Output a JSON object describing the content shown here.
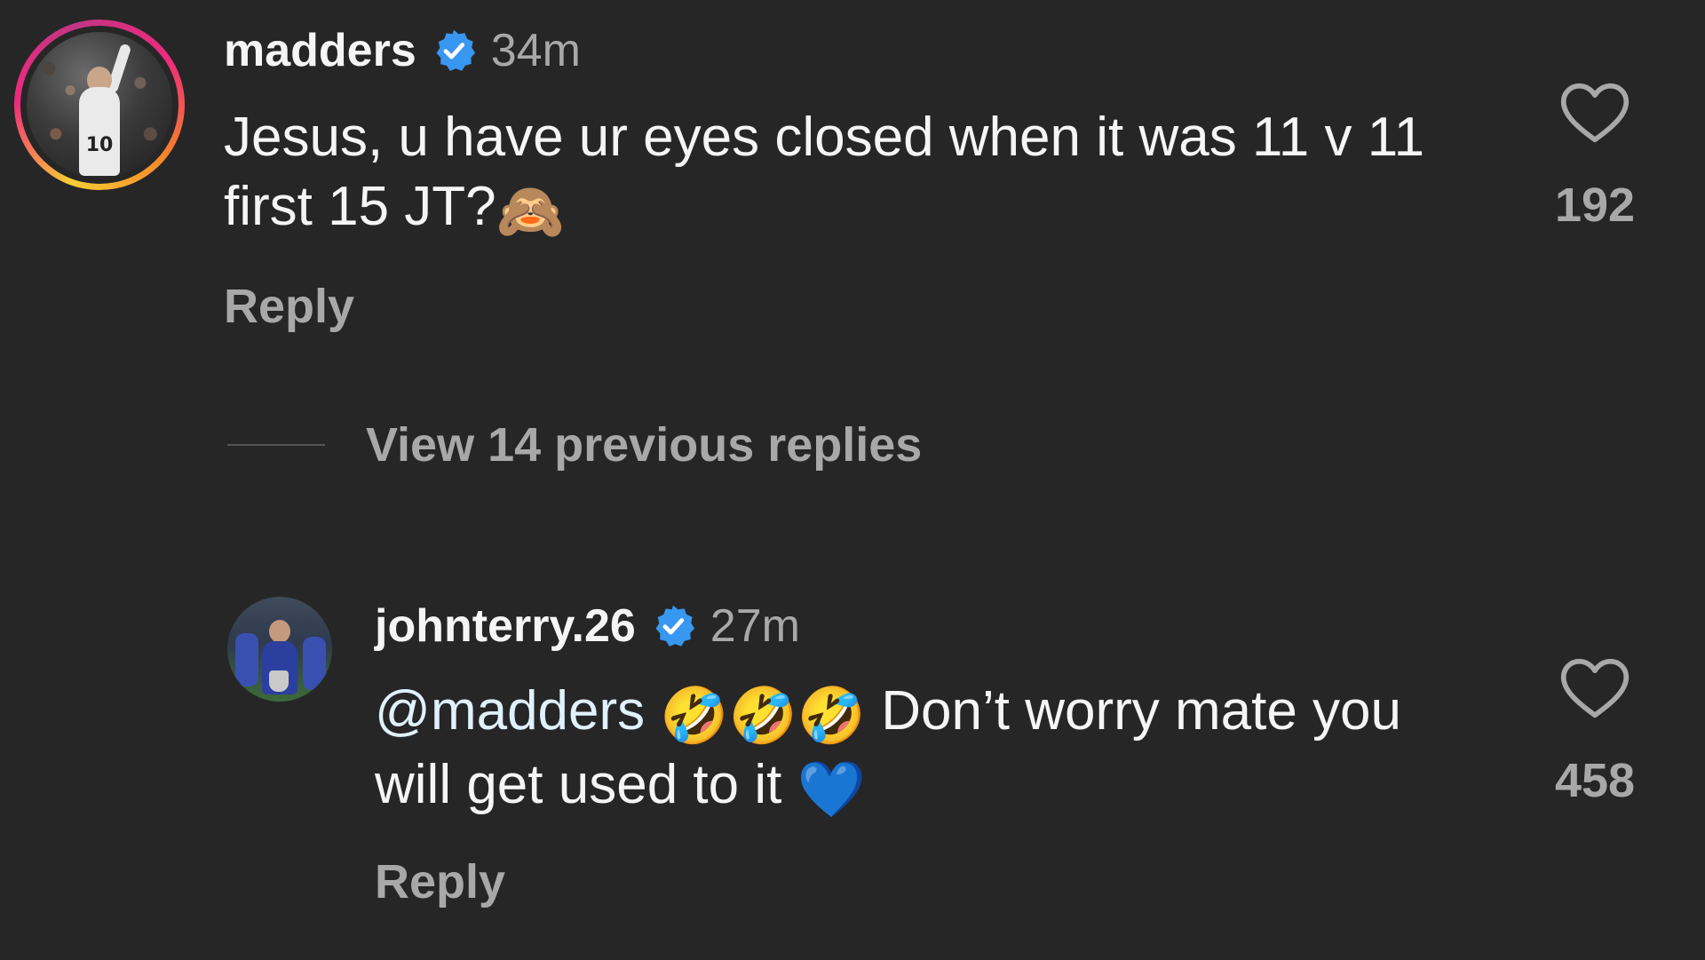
{
  "comment": {
    "username": "madders",
    "verified": true,
    "time": "34m",
    "text_main": "Jesus, u have ur eyes closed when it was 11 v 11 first 15 JT?",
    "text_emoji": "🙈",
    "reply_label": "Reply",
    "like_count": "192"
  },
  "thread": {
    "view_previous_label": "View 14 previous replies"
  },
  "reply": {
    "username": "johnterry.26",
    "verified": true,
    "time": "27m",
    "mention": "@madders",
    "emojis": "🤣🤣🤣",
    "text_main": "Don’t worry mate you will get used to it",
    "text_emoji": "💙",
    "reply_label": "Reply",
    "like_count": "458"
  },
  "colors": {
    "background": "#262626",
    "primary_text": "#f5f5f5",
    "secondary_text": "#a8a8a8",
    "verified_blue": "#3897f0"
  },
  "icons": {
    "verified": "verified-badge-icon",
    "like": "heart-outline-icon"
  }
}
